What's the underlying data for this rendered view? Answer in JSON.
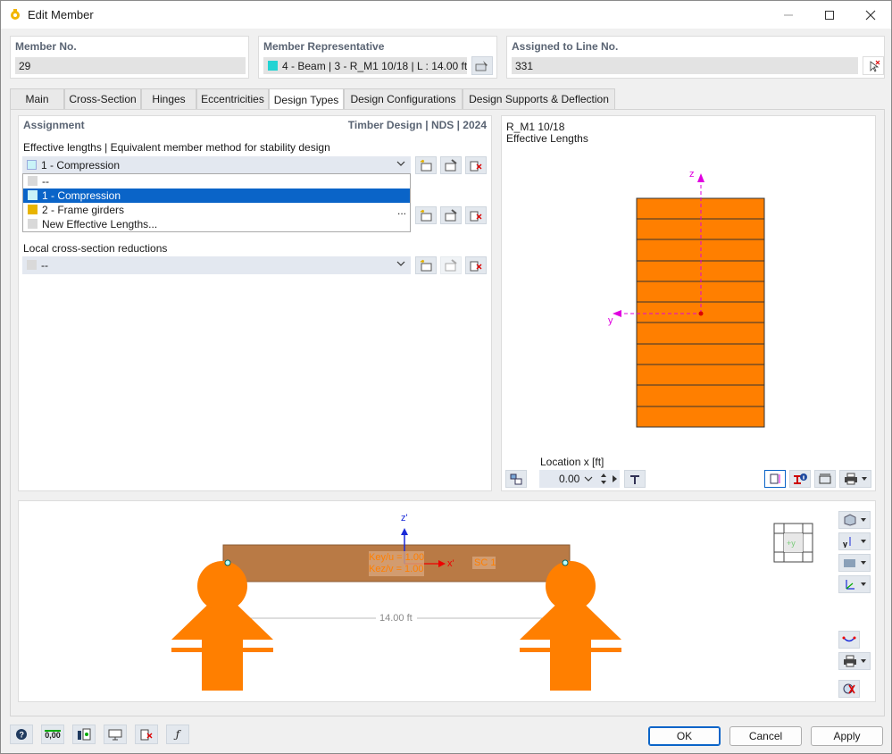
{
  "window": {
    "title": "Edit Member"
  },
  "member_no": {
    "label": "Member No.",
    "value": "29"
  },
  "member_rep": {
    "label": "Member Representative",
    "value": "4 - Beam | 3 - R_M1 10/18 | L : 14.00 ft |...",
    "swatch": "#22d3d3"
  },
  "assigned_line": {
    "label": "Assigned to Line No.",
    "value": "331"
  },
  "tabs": [
    "Main",
    "Cross-Section",
    "Hinges",
    "Eccentricities",
    "Design Types",
    "Design Configurations",
    "Design Supports & Deflection"
  ],
  "assignment": {
    "heading": "Assignment",
    "standard": "Timber Design | NDS | 2024",
    "eff_lengths_label": "Effective lengths | Equivalent member method for stability design",
    "eff_selected": "1 - Compression",
    "dropdown_items": [
      "--",
      "1 - Compression",
      "2 - Frame girders",
      "New Effective Lengths..."
    ],
    "dropdown_swatches": [
      "#d9d9d9",
      "#c9f3f8",
      "#e8b400",
      "#d9d9d9"
    ],
    "ellipsis": "...",
    "local_label": "Local cross-section reductions",
    "local_selected": "--"
  },
  "preview": {
    "section_name": "R_M1 10/18",
    "subtitle": "Effective Lengths",
    "axis_z": "z",
    "axis_y": "y",
    "location_label": "Location x [ft]",
    "location_value": "0.00"
  },
  "model": {
    "axis_z": "z'",
    "axis_x": "x'",
    "kyu": "Key/u = 1.00",
    "kzv": "Kez/v = 1.00",
    "sc": "SC 1",
    "length": "14.00 ft",
    "navcube_label": "+y"
  },
  "buttons": {
    "ok": "OK",
    "cancel": "Cancel",
    "apply": "Apply",
    "units_label": "0,00"
  },
  "colors": {
    "orange": "#ff7f00",
    "beam": "#b97a45",
    "accent": "#0a64c8",
    "magenta": "#e000e0"
  }
}
